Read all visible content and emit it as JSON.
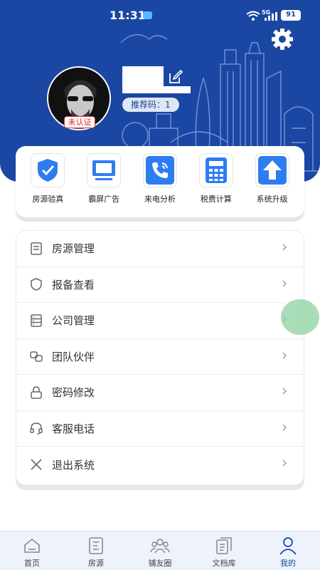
{
  "status_bar": {
    "time": "11:31",
    "network": "5G",
    "battery": "91"
  },
  "profile": {
    "verification_badge": "未认证",
    "referral_label": "推荐码：",
    "referral_code": "1"
  },
  "quick_actions": [
    {
      "label": "房源验真",
      "icon": "shield-check-icon"
    },
    {
      "label": "霸屏广告",
      "icon": "monitor-icon"
    },
    {
      "label": "来电分析",
      "icon": "phone-call-icon"
    },
    {
      "label": "税费计算",
      "icon": "calculator-icon"
    },
    {
      "label": "系统升级",
      "icon": "upgrade-arrow-icon"
    }
  ],
  "menu": [
    {
      "label": "房源管理",
      "icon": "document-icon"
    },
    {
      "label": "报备查看",
      "icon": "shield-outline-icon"
    },
    {
      "label": "公司管理",
      "icon": "cabinet-icon"
    },
    {
      "label": "团队伙伴",
      "icon": "link-icon"
    },
    {
      "label": "密码修改",
      "icon": "lock-icon"
    },
    {
      "label": "客服电话",
      "icon": "headset-icon"
    },
    {
      "label": "退出系统",
      "icon": "close-icon"
    }
  ],
  "tabbar": [
    {
      "label": "首页",
      "icon": "home-icon",
      "active": false
    },
    {
      "label": "房源",
      "icon": "listing-icon",
      "active": false
    },
    {
      "label": "铺友圈",
      "icon": "group-icon",
      "active": false
    },
    {
      "label": "文档库",
      "icon": "files-icon",
      "active": false
    },
    {
      "label": "我的",
      "icon": "user-icon",
      "active": true
    }
  ],
  "colors": {
    "header_blue": "#1a47a3",
    "action_blue": "#2e7df0",
    "badge_red": "#d22222"
  }
}
